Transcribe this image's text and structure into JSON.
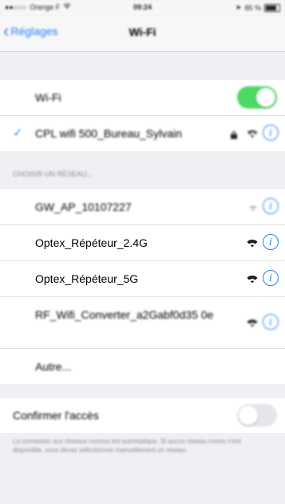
{
  "status_bar": {
    "carrier": "Orange F",
    "time": "09:24",
    "battery": "85 %"
  },
  "nav": {
    "back_label": "Réglages",
    "title": "Wi-Fi"
  },
  "wifi_toggle": {
    "label": "Wi-Fi",
    "state": "on"
  },
  "connected": {
    "name": "CPL wifi 500_Bureau_Sylvain",
    "icons": [
      "check-icon",
      "lock-icon",
      "wifi-icon",
      "info-icon"
    ]
  },
  "section_header": "CHOISIR UN RÉSEAU...",
  "networks": [
    {
      "name": "GW_AP_10107227"
    },
    {
      "name": "Optex_Répéteur_2.4G"
    },
    {
      "name": "Optex_Répéteur_5G"
    },
    {
      "name": "RF_Wifi_Converter_a2Gabf0d35 0e"
    }
  ],
  "other": "Autre...",
  "ask_join": {
    "label": "Confirmer l'accès",
    "state": "off"
  },
  "footer": "La connexion aux réseaux connus est automatique. Si aucun réseau connu n'est disponible, vous devez sélectionner manuellement un réseau.",
  "colors": {
    "accent": "#2a7cf6",
    "toggle_on": "#4cd964",
    "background": "#efeff4"
  }
}
